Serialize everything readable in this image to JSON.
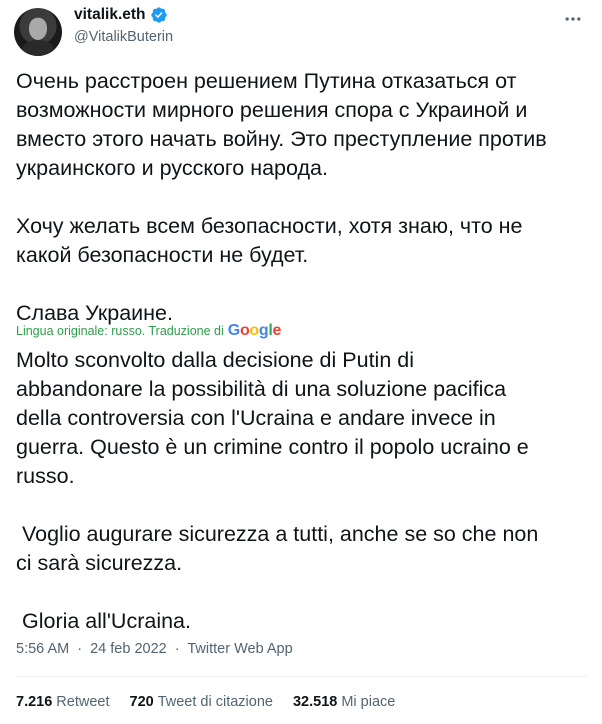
{
  "author": {
    "display_name": "vitalik.eth",
    "handle": "@VitalikButerin"
  },
  "tweet": {
    "text": "Очень расстроен решением Путина отказаться от\nвозможности мирного решения спора с Украиной и\nвместо этого начать войну. Это преступление против\nукраинского и русского народа.\n\nХочу желать всем безопасности, хотя знаю, что не\nкакой безопасности не будет.\n\nСлава Украине.",
    "translation_note": "Lingua originale: russo. Traduzione di",
    "translation_provider": "Google",
    "translated_text": "Molto sconvolto dalla decisione di Putin di\nabbandonare la possibilità di una soluzione pacifica\ndella controversia con l'Ucraina e andare invece in\nguerra. Questo è un crimine contro il popolo ucraino e\nrusso.\n\n Voglio augurare sicurezza a tutti, anche se so che non\nci sarà sicurezza.\n\n Gloria all'Ucraina."
  },
  "meta": {
    "time": "5:56 AM",
    "date": "24 feb 2022",
    "separator": "·",
    "source": "Twitter Web App"
  },
  "stats": [
    {
      "value": "7.216",
      "label": "Retweet"
    },
    {
      "value": "720",
      "label": "Tweet di citazione"
    },
    {
      "value": "32.518",
      "label": "Mi piace"
    }
  ],
  "colors": {
    "verified_badge": "#1d9bf0",
    "translation_note": "#2e9e4a",
    "secondary_text": "#536471"
  },
  "icons": {
    "verified": "verified-badge-icon",
    "more": "more-horizontal-icon"
  }
}
